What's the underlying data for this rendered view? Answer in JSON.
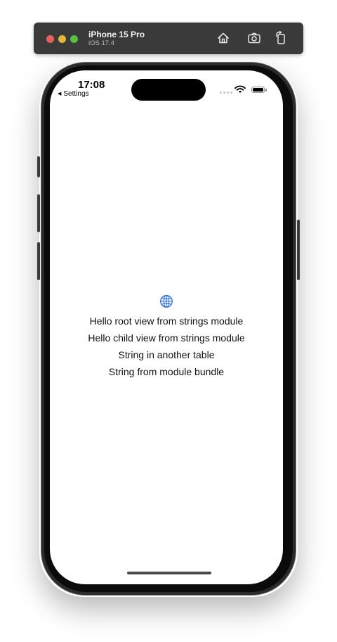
{
  "simulator": {
    "device_name": "iPhone 15 Pro",
    "os_version": "iOS 17.4",
    "icons": [
      "home-icon",
      "screenshot-icon",
      "rotate-icon"
    ]
  },
  "status_bar": {
    "time": "17:08",
    "back_label": "Settings",
    "battery_level": 1.0
  },
  "app": {
    "icon": "globe-icon",
    "accent_color": "#2f6fdb",
    "lines": [
      "Hello root view from strings module",
      "Hello child view from strings module",
      "String in another table",
      "String from module bundle"
    ]
  }
}
